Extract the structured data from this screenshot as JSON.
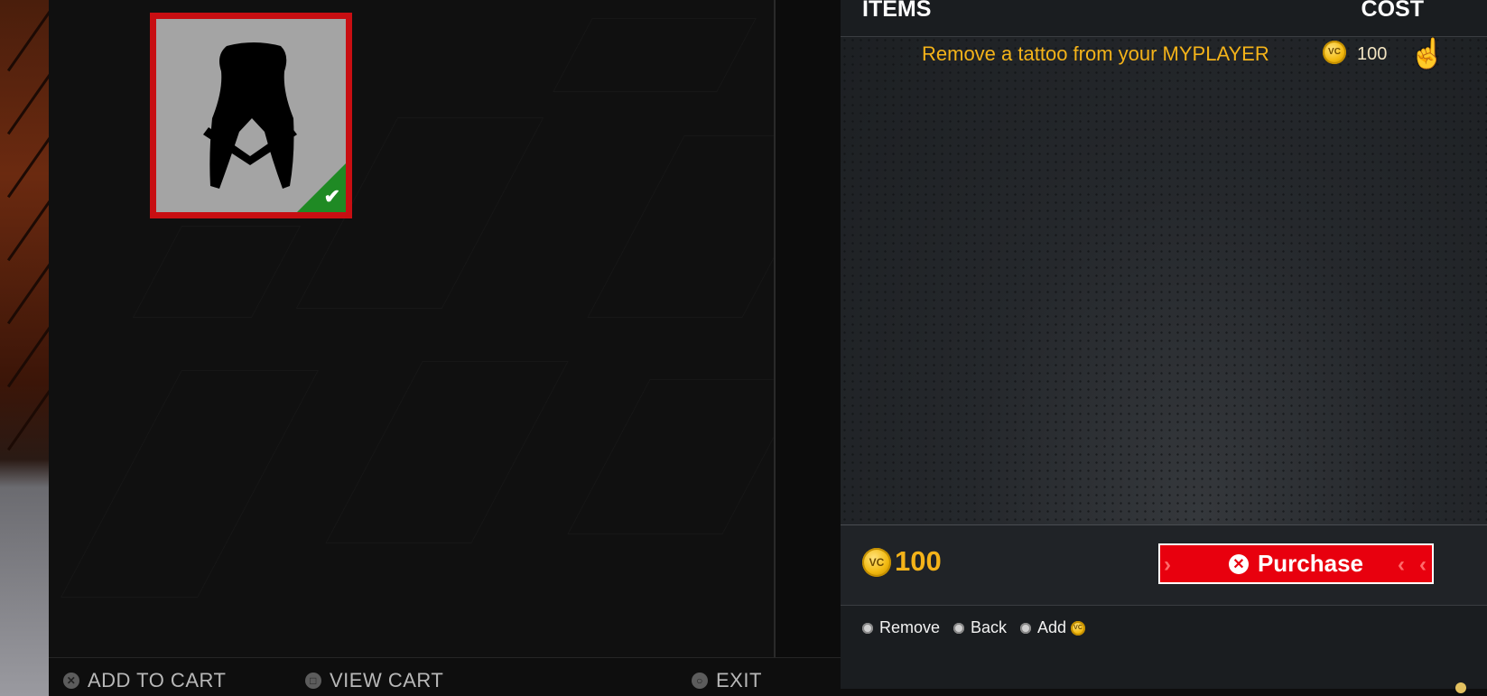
{
  "cart": {
    "header": {
      "items_label": "ITEMS",
      "cost_label": "COST"
    },
    "items": [
      {
        "description": "Remove a tattoo from your MYPLAYER",
        "currency_icon": "vc-coin-icon",
        "cost": "100"
      }
    ],
    "total": {
      "currency_icon": "vc-coin-icon",
      "amount": "100"
    },
    "purchase_button": {
      "label": "Purchase",
      "icon": "cross-button-icon"
    },
    "controls": [
      {
        "label": "Remove",
        "icon": "square-button-icon"
      },
      {
        "label": "Back",
        "icon": "circle-button-icon"
      },
      {
        "label": "Add",
        "icon": "triangle-button-icon",
        "suffix_icon": "vc-coin-icon"
      }
    ]
  },
  "tile": {
    "selected": true,
    "checked": true,
    "check_icon": "checkmark-icon",
    "image_icon": "tattoo-remove-silhouette-icon"
  },
  "bottom_bar": {
    "add_to_cart": "ADD TO CART",
    "view_cart": "VIEW CART",
    "exit": "EXIT"
  },
  "colors": {
    "accent_red": "#e8000e",
    "vc_gold": "#f4b319",
    "check_green": "#1f8a24"
  }
}
